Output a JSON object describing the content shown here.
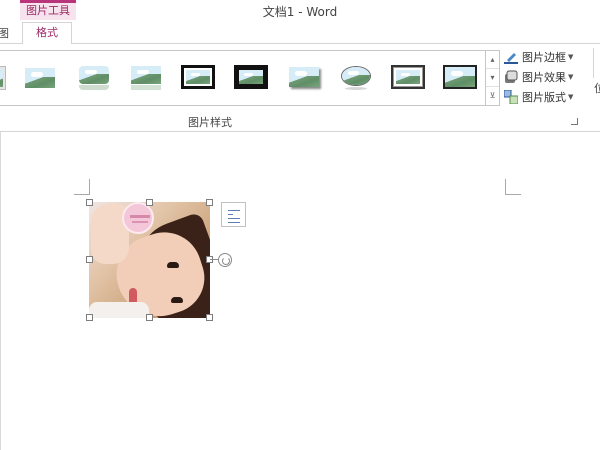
{
  "window": {
    "title": "文档1 - Word",
    "context_tab": "图片工具"
  },
  "tabs": {
    "partial_left": "图",
    "format": "格式"
  },
  "ribbon": {
    "picture_styles_group_label": "图片样式",
    "right_edge_partial": "位",
    "commands": {
      "picture_border": "图片边框",
      "picture_effects": "图片效果",
      "picture_layout": "图片版式"
    },
    "picture_styles": [
      {
        "name": "simple-frame-white"
      },
      {
        "name": "soft-edge"
      },
      {
        "name": "reflected-rounded"
      },
      {
        "name": "reflected-bevel"
      },
      {
        "name": "thick-black-frame"
      },
      {
        "name": "double-black-frame"
      },
      {
        "name": "drop-shadow-rectangle"
      },
      {
        "name": "oval-soft"
      },
      {
        "name": "metal-frame"
      },
      {
        "name": "simple-black-frame"
      }
    ]
  },
  "colors": {
    "accent": "#b8357b",
    "tab_text": "#9b2a66"
  }
}
